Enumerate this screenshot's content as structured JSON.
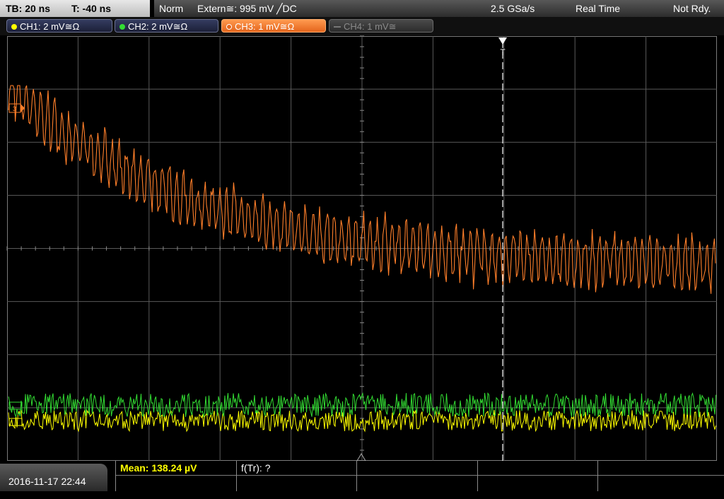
{
  "timebase": {
    "tb": "TB: 20 ns",
    "trig_time": "T: -40 ns"
  },
  "acquisition": {
    "mode": "Norm",
    "trigger": "Extern≅: 995 mV ╱DC",
    "sample_rate": "2.5 GSa/s",
    "realtime": "Real Time",
    "status": "Not Rdy."
  },
  "channels": [
    {
      "label": "CH1: 2 mV≅Ω",
      "color": "#ffff00",
      "state": "on"
    },
    {
      "label": "CH2: 2 mV≅Ω",
      "color": "#33dd33",
      "state": "on"
    },
    {
      "label": "CH3: 1 mV≅Ω",
      "color": "#ff7f2a",
      "state": "selected"
    },
    {
      "label": "CH4: 1 mV≅",
      "color": "#777777",
      "state": "off"
    }
  ],
  "markers": {
    "ch3": "3",
    "trigger": "T"
  },
  "measurements": {
    "mean": "Mean: 138.24 µV",
    "freq": "f(Tr): ?"
  },
  "datetime": "2016-11-17 22:44",
  "colors": {
    "grid": "#5a5a5a",
    "ch1": "#ffff00",
    "ch2": "#33dd33",
    "ch3": "#ff7f2a"
  }
}
